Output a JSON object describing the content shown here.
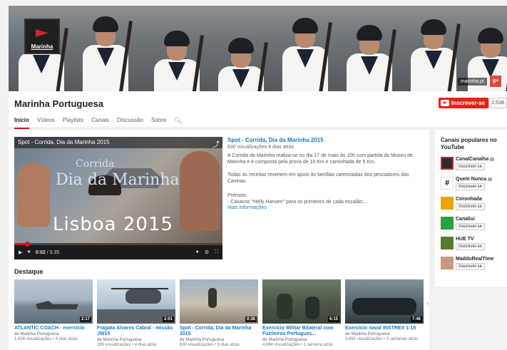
{
  "banner": {
    "logo_text": "Marinha",
    "link_text": "marinha.pt",
    "gplus_text": "g+"
  },
  "header": {
    "channel_name": "Marinha Portuguesa",
    "subscribe_label": "Inscrever-se",
    "subscriber_count": "2.538",
    "tabs": [
      "Início",
      "Vídeos",
      "Playlists",
      "Canais",
      "Discussão",
      "Sobre"
    ],
    "active_tab": "Início"
  },
  "player": {
    "title": "Spot - Corrida, Dia da Marinha 2015",
    "overlay_line1": "Corrida",
    "overlay_line2": "Dia da Marinha",
    "overlay_line3": "Lisboa 2015",
    "time_current": "0:02",
    "time_total": "0:35",
    "progress": 0.06
  },
  "video_info": {
    "title": "Spot - Corrida, Dia da Marinha 2015",
    "meta": "630 visualizações  6 dias atrás",
    "desc1": "A Corrida da Marinha realiza-se no dia 17 de maio às 10h com partida do Museu de Marinha e é composta pela prova de 10 Km e caminhada de 5 Km.",
    "desc2": "Todas as receitas revertem em apoio às famílias carenciadas dos pescadores das Caxinas.",
    "desc3": "Prémios:",
    "desc4": "- Casacos \"Helly Hansen\" para os primeiros de cada escalão;...",
    "more": "Mais informações"
  },
  "featured": {
    "title": "Destaque",
    "items": [
      {
        "title": "ATLANTIC COACH - exercício",
        "channel": "de Marinha Portuguesa",
        "meta": "1.626 visualizações • 4 dias atrás",
        "duration": "2:17"
      },
      {
        "title": "Fragata Alvares Cabral - missão JW15",
        "channel": "de Marinha Portuguesa",
        "meta": "286 visualizações • 4 dias atrás",
        "duration": "2:01"
      },
      {
        "title": "Spot - Corrida, Dia da Marinha 2015",
        "channel": "de Marinha Portuguesa",
        "meta": "630 visualizações • 6 dias atrás",
        "duration": "0:36"
      },
      {
        "title": "Exercício Militar Bilateral com Fuzileiros Portugues...",
        "channel": "de Marinha Portuguesa",
        "meta": "4.664 visualizações • 1 semana atrás",
        "duration": "6:15"
      },
      {
        "title": "Exercício naval INSTREX 1-15",
        "channel": "de Marinha Portuguesa",
        "meta": "3.692 visualizações • 3 semanas atrás",
        "duration": "7:46"
      }
    ]
  },
  "sidebar": {
    "title": "Canais populares no YouTube",
    "subscribe_label": "Inscrever-se",
    "channels": [
      {
        "name": "CanalCanalha"
      },
      {
        "name": "Quem Nunca"
      },
      {
        "name": "Coronhada"
      },
      {
        "name": "Canalixi"
      },
      {
        "name": "HUE TV"
      },
      {
        "name": "MadduRealTime"
      }
    ]
  }
}
